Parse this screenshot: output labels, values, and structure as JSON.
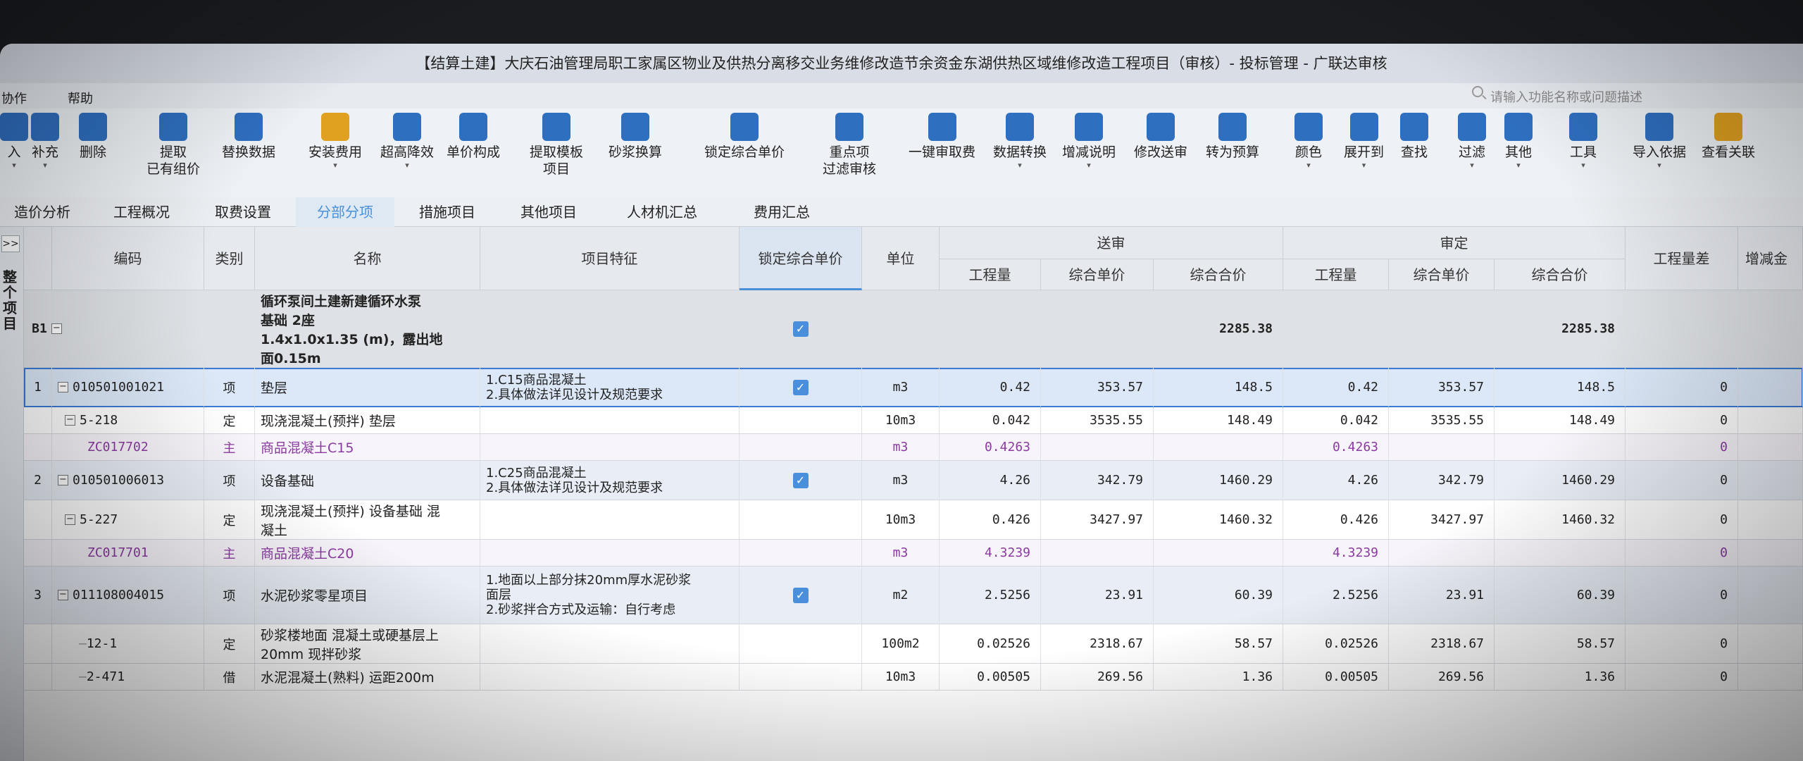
{
  "title": "【结算土建】大庆石油管理局职工家属区物业及供热分离移交业务维修改造节余资金东湖供热区域维修改造工程项目（审核）- 投标管理 - 广联达审核",
  "menu": [
    "协作",
    "帮助"
  ],
  "search_placeholder": "请输入功能名称或问题描述",
  "toolbar": [
    {
      "label": "入",
      "icon": "insert-icon",
      "color": "#2f6fc0",
      "dropdown": true
    },
    {
      "label": "补充",
      "icon": "supplement-icon",
      "color": "#2f6fc0",
      "dropdown": true
    },
    {
      "label": "删除",
      "icon": "trash-icon",
      "color": "#2f6fc0",
      "dropdown": false
    },
    {
      "label": "提取\n已有组价",
      "icon": "extract-icon",
      "color": "#2f6fc0",
      "dropdown": false
    },
    {
      "label": "替换数据",
      "icon": "replace-icon",
      "color": "#2f6fc0",
      "dropdown": false
    },
    {
      "label": "安装费用",
      "icon": "install-fee-icon",
      "color": "#e0a020",
      "dropdown": true
    },
    {
      "label": "超高降效",
      "icon": "height-icon",
      "color": "#2f6fc0",
      "dropdown": true
    },
    {
      "label": "单价构成",
      "icon": "price-structure-icon",
      "color": "#2f6fc0",
      "dropdown": false
    },
    {
      "label": "提取模板\n项目",
      "icon": "template-icon",
      "color": "#2f6fc0",
      "dropdown": false
    },
    {
      "label": "砂浆换算",
      "icon": "mortar-icon",
      "color": "#2f6fc0",
      "dropdown": false
    },
    {
      "label": "锁定综合单价",
      "icon": "lock-icon",
      "color": "#2f6fc0",
      "dropdown": false
    },
    {
      "label": "重点项\n过滤审核",
      "icon": "filter-audit-icon",
      "color": "#2f6fc0",
      "dropdown": false
    },
    {
      "label": "一键审取费",
      "icon": "audit-fee-icon",
      "color": "#2f6fc0",
      "dropdown": false
    },
    {
      "label": "数据转换",
      "icon": "data-convert-icon",
      "color": "#2f6fc0",
      "dropdown": true
    },
    {
      "label": "增减说明",
      "icon": "change-note-icon",
      "color": "#2f6fc0",
      "dropdown": true
    },
    {
      "label": "修改送审",
      "icon": "edit-submit-icon",
      "color": "#2f6fc0",
      "dropdown": false
    },
    {
      "label": "转为预算",
      "icon": "to-budget-icon",
      "color": "#2f6fc0",
      "dropdown": false
    },
    {
      "label": "颜色",
      "icon": "color-icon",
      "color": "#2f6fc0",
      "dropdown": true
    },
    {
      "label": "展开到",
      "icon": "expand-icon",
      "color": "#2f6fc0",
      "dropdown": true
    },
    {
      "label": "查找",
      "icon": "find-icon",
      "color": "#2f6fc0",
      "dropdown": false
    },
    {
      "label": "过滤",
      "icon": "filter-icon",
      "color": "#2f6fc0",
      "dropdown": true
    },
    {
      "label": "其他",
      "icon": "other-icon",
      "color": "#2f6fc0",
      "dropdown": true
    },
    {
      "label": "工具",
      "icon": "tools-icon",
      "color": "#2f6fc0",
      "dropdown": true
    },
    {
      "label": "导入依据",
      "icon": "import-basis-icon",
      "color": "#2f6fc0",
      "dropdown": true
    },
    {
      "label": "查看关联",
      "icon": "view-relation-icon",
      "color": "#e0a020",
      "dropdown": false
    }
  ],
  "tabs": [
    "造价分析",
    "工程概况",
    "取费设置",
    "分部分项",
    "措施项目",
    "其他项目",
    "人材机汇总",
    "费用汇总"
  ],
  "active_tab": "分部分项",
  "side_label": "整个项目",
  "side_expand": ">>",
  "columns": {
    "code": "编码",
    "type": "类别",
    "name": "名称",
    "features": "项目特征",
    "lock": "锁定综合单价",
    "unit": "单位",
    "submitted": "送审",
    "approved": "审定",
    "qty": "工程量",
    "unit_price": "综合单价",
    "total": "综合合价",
    "qty_diff": "工程量差",
    "incr": "增减金"
  },
  "rows": [
    {
      "kind": "grp",
      "idx": "B1",
      "code": "",
      "type": "",
      "name": "循环泵间土建新建循环水泵\n基础 2座\n1.4x1.0x1.35 (m)，露出地\n面0.15m",
      "features": "",
      "lock": true,
      "unit": "",
      "s_qty": "",
      "s_price": "",
      "s_total": "2285.38",
      "a_qty": "",
      "a_price": "",
      "a_total": "2285.38",
      "diff": ""
    },
    {
      "kind": "item",
      "idx": "1",
      "code": "010501001021",
      "type": "项",
      "name": "垫层",
      "features": "1.C15商品混凝土\n2.具体做法详见设计及规范要求",
      "lock": true,
      "unit": "m3",
      "s_qty": "0.42",
      "s_price": "353.57",
      "s_total": "148.5",
      "a_qty": "0.42",
      "a_price": "353.57",
      "a_total": "148.5",
      "diff": "0"
    },
    {
      "kind": "sub",
      "idx": "",
      "code": "5-218",
      "type": "定",
      "name": "现浇混凝土(预拌) 垫层",
      "features": "",
      "lock": false,
      "unit": "10m3",
      "s_qty": "0.042",
      "s_price": "3535.55",
      "s_total": "148.49",
      "a_qty": "0.042",
      "a_price": "3535.55",
      "a_total": "148.49",
      "diff": "0"
    },
    {
      "kind": "mat",
      "idx": "",
      "code": "ZC017702",
      "type": "主",
      "name": "商品混凝土C15",
      "features": "",
      "lock": false,
      "unit": "m3",
      "s_qty": "0.4263",
      "s_price": "",
      "s_total": "",
      "a_qty": "0.4263",
      "a_price": "",
      "a_total": "",
      "diff": "0"
    },
    {
      "kind": "item",
      "idx": "2",
      "code": "010501006013",
      "type": "项",
      "name": "设备基础",
      "features": "1.C25商品混凝土\n2.具体做法详见设计及规范要求",
      "lock": true,
      "unit": "m3",
      "s_qty": "4.26",
      "s_price": "342.79",
      "s_total": "1460.29",
      "a_qty": "4.26",
      "a_price": "342.79",
      "a_total": "1460.29",
      "diff": "0"
    },
    {
      "kind": "sub",
      "idx": "",
      "code": "5-227",
      "type": "定",
      "name": "现浇混凝土(预拌) 设备基础 混\n凝土",
      "features": "",
      "lock": false,
      "unit": "10m3",
      "s_qty": "0.426",
      "s_price": "3427.97",
      "s_total": "1460.32",
      "a_qty": "0.426",
      "a_price": "3427.97",
      "a_total": "1460.32",
      "diff": "0"
    },
    {
      "kind": "mat",
      "idx": "",
      "code": "ZC017701",
      "type": "主",
      "name": "商品混凝土C20",
      "features": "",
      "lock": false,
      "unit": "m3",
      "s_qty": "4.3239",
      "s_price": "",
      "s_total": "",
      "a_qty": "4.3239",
      "a_price": "",
      "a_total": "",
      "diff": "0"
    },
    {
      "kind": "item",
      "idx": "3",
      "code": "011108004015",
      "type": "项",
      "name": "水泥砂浆零星项目",
      "features": "1.地面以上部分抹20mm厚水泥砂浆\n面层\n2.砂浆拌合方式及运输：自行考虑",
      "lock": true,
      "unit": "m2",
      "s_qty": "2.5256",
      "s_price": "23.91",
      "s_total": "60.39",
      "a_qty": "2.5256",
      "a_price": "23.91",
      "a_total": "60.39",
      "diff": "0"
    },
    {
      "kind": "sub",
      "idx": "",
      "code": "12-1",
      "type": "定",
      "name": "砂浆楼地面 混凝土或硬基层上\n20mm 现拌砂浆",
      "features": "",
      "lock": false,
      "unit": "100m2",
      "s_qty": "0.02526",
      "s_price": "2318.67",
      "s_total": "58.57",
      "a_qty": "0.02526",
      "a_price": "2318.67",
      "a_total": "58.57",
      "diff": "0"
    },
    {
      "kind": "sub",
      "idx": "",
      "code": "2-471",
      "type": "借",
      "name": "水泥混凝土(熟料) 运距200m",
      "features": "",
      "lock": false,
      "unit": "10m3",
      "s_qty": "0.00505",
      "s_price": "269.56",
      "s_total": "1.36",
      "a_qty": "0.00505",
      "a_price": "269.56",
      "a_total": "1.36",
      "diff": "0"
    }
  ]
}
